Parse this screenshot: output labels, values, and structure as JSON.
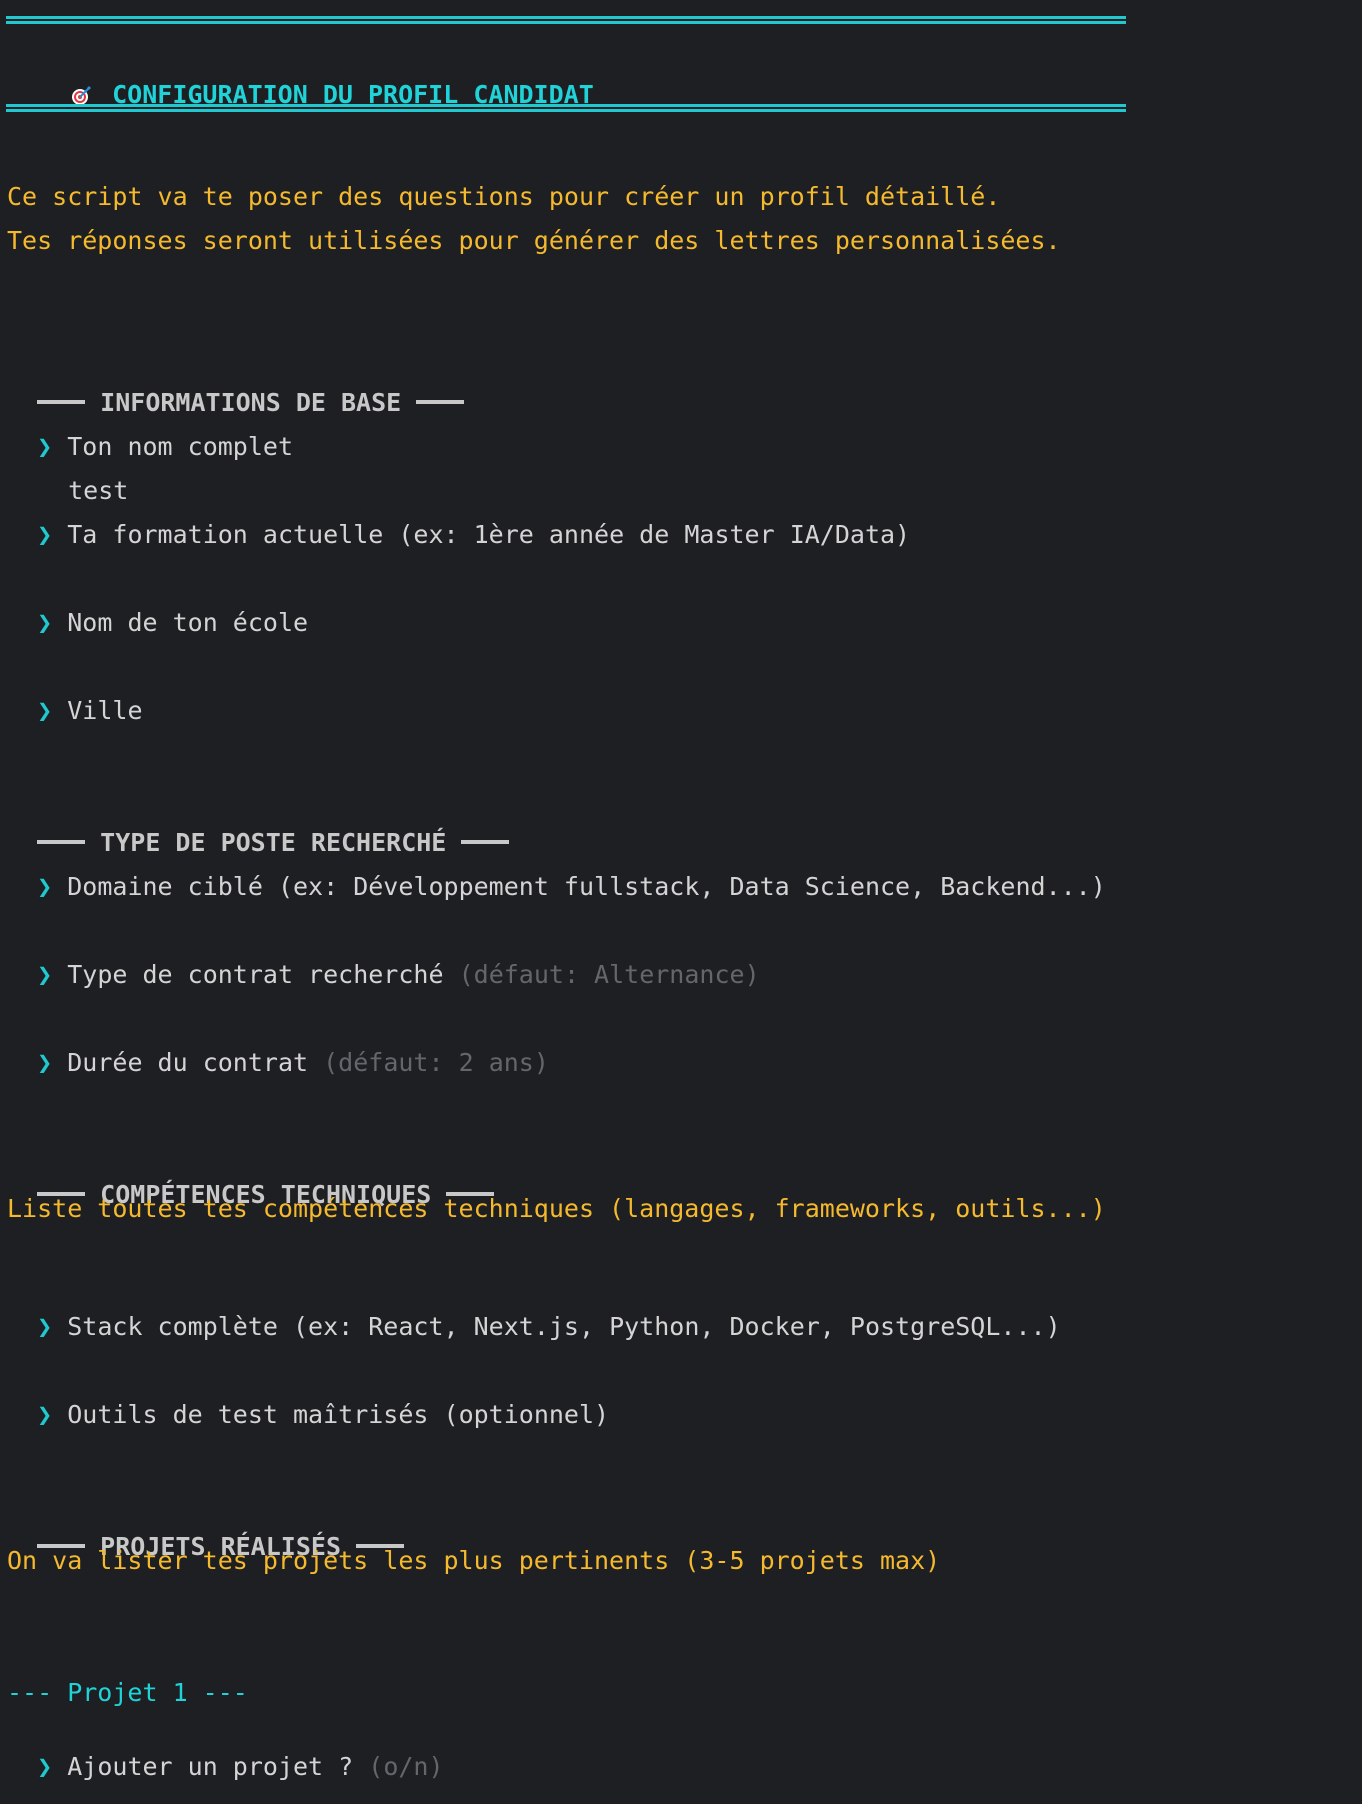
{
  "header": {
    "icon": "target-icon",
    "title": "CONFIGURATION DU PROFIL CANDIDAT"
  },
  "intro": {
    "line1": "Ce script va te poser des questions pour créer un profil détaillé.",
    "line2": "Tes réponses seront utilisées pour générer des lettres personnalisées."
  },
  "prompt_symbol": "❯",
  "sections": {
    "base": {
      "title": "INFORMATIONS DE BASE",
      "q_nom": "Ton nom complet",
      "a_nom": "test",
      "q_formation": "Ta formation actuelle (ex: 1ère année de Master IA/Data)",
      "q_ecole": "Nom de ton école",
      "q_ville": "Ville"
    },
    "poste": {
      "title": "TYPE DE POSTE RECHERCHÉ",
      "q_domaine": "Domaine ciblé (ex: Développement fullstack, Data Science, Backend...)",
      "q_contrat": "Type de contrat recherché",
      "d_contrat": "(défaut: Alternance)",
      "q_duree": "Durée du contrat",
      "d_duree": "(défaut: 2 ans)"
    },
    "competences": {
      "title": "COMPÉTENCES TECHNIQUES",
      "hint": "Liste toutes tes compétences techniques (langages, frameworks, outils...)",
      "q_stack": "Stack complète (ex: React, Next.js, Python, Docker, PostgreSQL...)",
      "q_tests": "Outils de test maîtrisés (optionnel)"
    },
    "projets": {
      "title": "PROJETS RÉALISÉS",
      "hint": "On va lister tes projets les plus pertinents (3-5 projets max)",
      "sub": "--- Projet 1 ---",
      "q_ajouter": "Ajouter un projet ?",
      "d_ajouter": "(o/n)"
    }
  },
  "colors": {
    "background": "#1e1f22",
    "accent_cyan": "#1fd3d8",
    "hint_yellow": "#f5b92e",
    "default_gray": "#64666b"
  }
}
